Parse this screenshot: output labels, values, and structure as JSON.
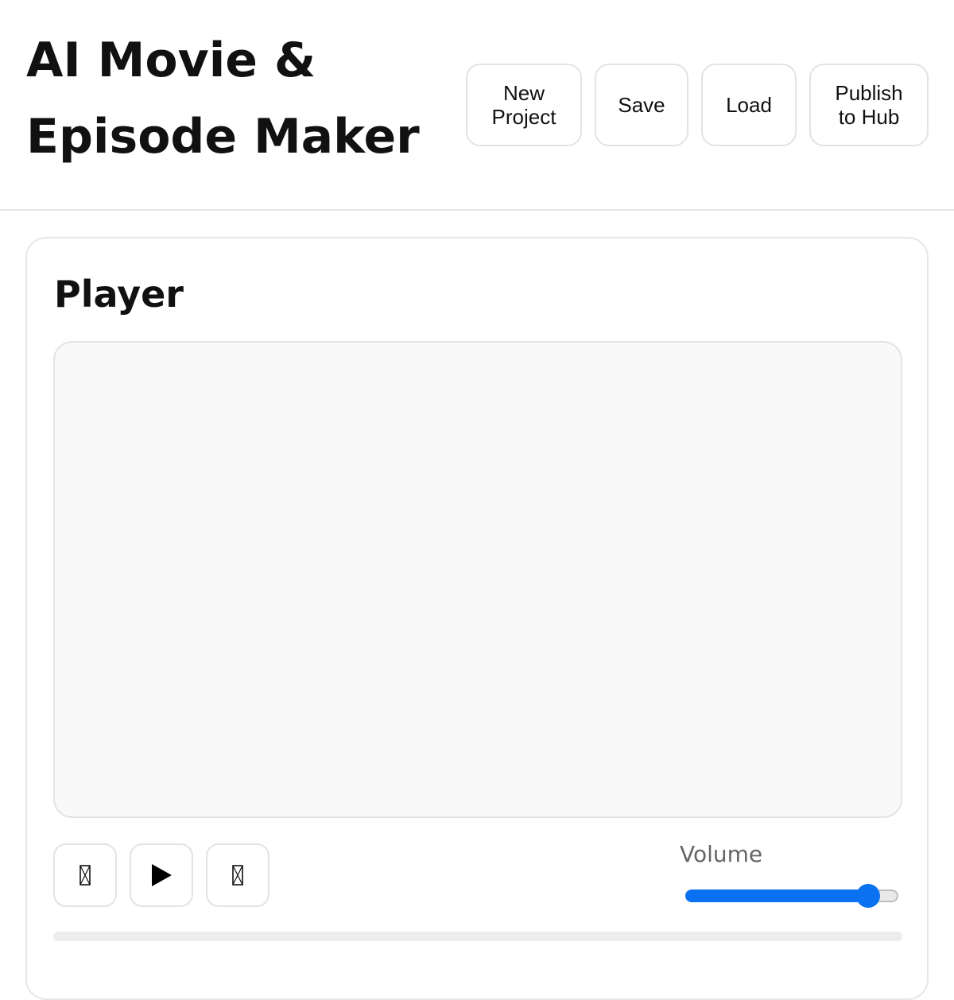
{
  "header": {
    "title": "AI Movie & Episode Maker",
    "buttons": {
      "new_project": "New Project",
      "save": "Save",
      "load": "Load",
      "publish": "Publish to Hub"
    }
  },
  "player": {
    "title": "Player",
    "controls": {
      "prev_icon": "missing-glyph-icon",
      "play_icon": "play-icon",
      "next_icon": "missing-glyph-icon"
    },
    "volume": {
      "label": "Volume",
      "level": 0.86
    },
    "progress": 0
  },
  "colors": {
    "accent": "#0a72f0",
    "border": "#e3e3e3",
    "viewport_bg": "#f9f9f9",
    "muted_text": "#666666"
  }
}
